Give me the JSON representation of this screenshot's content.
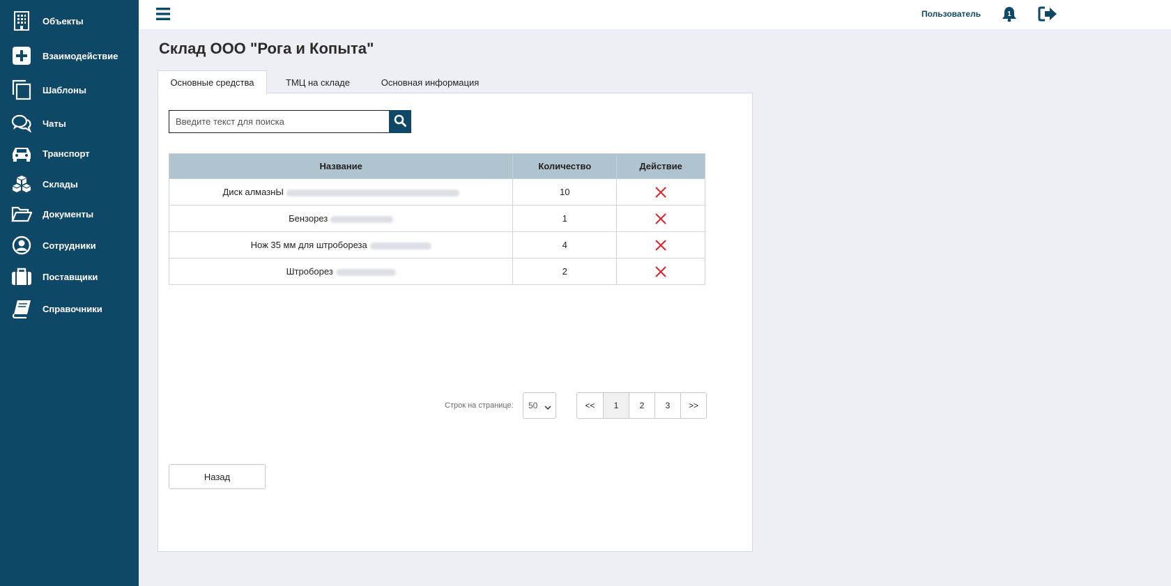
{
  "sidebar": {
    "items": [
      {
        "label": "Объекты",
        "icon": "building-icon"
      },
      {
        "label": "Взаимодействие",
        "icon": "plus-square-icon"
      },
      {
        "label": "Шаблоны",
        "icon": "copy-icon"
      },
      {
        "label": "Чаты",
        "icon": "chat-icon"
      },
      {
        "label": "Транспорт",
        "icon": "car-icon"
      },
      {
        "label": "Склады",
        "icon": "boxes-icon"
      },
      {
        "label": "Документы",
        "icon": "folder-open-icon"
      },
      {
        "label": "Сотрудники",
        "icon": "user-circle-icon"
      },
      {
        "label": "Поставщики",
        "icon": "briefcase-icon"
      },
      {
        "label": "Справочники",
        "icon": "book-icon"
      }
    ]
  },
  "header": {
    "user_label": "Пользователь",
    "notification_count": "1"
  },
  "page": {
    "title": "Склад ООО \"Рога и Копыта\""
  },
  "tabs": [
    {
      "label": "Основные средства",
      "active": true
    },
    {
      "label": "ТМЦ на складе",
      "active": false
    },
    {
      "label": "Основная информация",
      "active": false
    }
  ],
  "search": {
    "placeholder": "Введите текст для поиска",
    "value": ""
  },
  "table": {
    "headers": [
      "Название",
      "Количество",
      "Действие"
    ],
    "rows": [
      {
        "name": "Диск алмазнЫ",
        "qty": "10"
      },
      {
        "name": "Бензорез",
        "qty": "1"
      },
      {
        "name": "Нож 35 мм для штробореза",
        "qty": "4"
      },
      {
        "name": "Штроборез",
        "qty": "2"
      }
    ]
  },
  "pagination": {
    "rows_label": "Строк на странице:",
    "rows_per_page": "50",
    "first": "<<",
    "pages": [
      "1",
      "2",
      "3"
    ],
    "current_page": "1",
    "last": ">>"
  },
  "actions": {
    "back_label": "Назад"
  },
  "colors": {
    "sidebar": "#0f4766",
    "table_header": "#b0c4cf",
    "delete": "#d9262c",
    "background": "#eeeff5"
  }
}
